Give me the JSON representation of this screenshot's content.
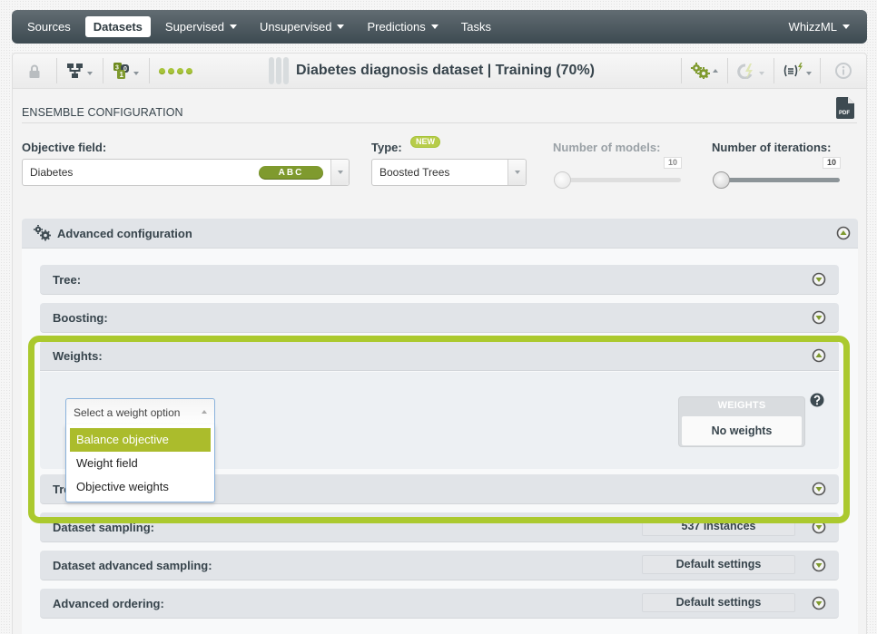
{
  "nav": {
    "items": [
      {
        "label": "Sources",
        "active": false,
        "dropdown": false
      },
      {
        "label": "Datasets",
        "active": true,
        "dropdown": false
      },
      {
        "label": "Supervised",
        "active": false,
        "dropdown": true
      },
      {
        "label": "Unsupervised",
        "active": false,
        "dropdown": true
      },
      {
        "label": "Predictions",
        "active": false,
        "dropdown": true
      },
      {
        "label": "Tasks",
        "active": false,
        "dropdown": false
      }
    ],
    "right_item": {
      "label": "WhizzML",
      "dropdown": true
    }
  },
  "toolbar": {
    "title": "Diabetes diagnosis dataset | Training (70%)",
    "left_icons": [
      "lock-icon",
      "tree-structure-icon",
      "field-types-icon",
      "status-dots-icon"
    ],
    "right_icons": [
      "configure-gears-icon",
      "one-click-lightning-icon",
      "formula-lightning-icon",
      "info-icon"
    ],
    "accent_color": "#a7c43a"
  },
  "config": {
    "section_title": "ENSEMBLE CONFIGURATION",
    "pdf_label": "PDF",
    "objective": {
      "label": "Objective field:",
      "value": "Diabetes",
      "type_badge": "ABC"
    },
    "type": {
      "label": "Type:",
      "badge": "NEW",
      "value": "Boosted Trees"
    },
    "num_models": {
      "label": "Number of models:",
      "value": "10",
      "enabled": false,
      "position": 0
    },
    "num_iterations": {
      "label": "Number of iterations:",
      "value": "10",
      "enabled": true,
      "position": 0
    }
  },
  "advanced": {
    "title": "Advanced configuration",
    "sections": [
      {
        "label": "Tree:",
        "value": null,
        "expanded": false
      },
      {
        "label": "Boosting:",
        "value": null,
        "expanded": false
      },
      {
        "label": "Weights:",
        "value": null,
        "expanded": true
      },
      {
        "label": "Tree sampling:",
        "value": null,
        "expanded": false
      },
      {
        "label": "Dataset sampling:",
        "value": "537 instances",
        "expanded": false
      },
      {
        "label": "Dataset advanced sampling:",
        "value": "Default settings",
        "expanded": false
      },
      {
        "label": "Advanced ordering:",
        "value": "Default settings",
        "expanded": false
      }
    ],
    "weights": {
      "select_placeholder": "Select a weight option",
      "options": [
        "Balance objective",
        "Weight field",
        "Objective weights"
      ],
      "highlighted_option": "Balance objective",
      "box_title": "WEIGHTS",
      "box_value": "No weights"
    }
  }
}
